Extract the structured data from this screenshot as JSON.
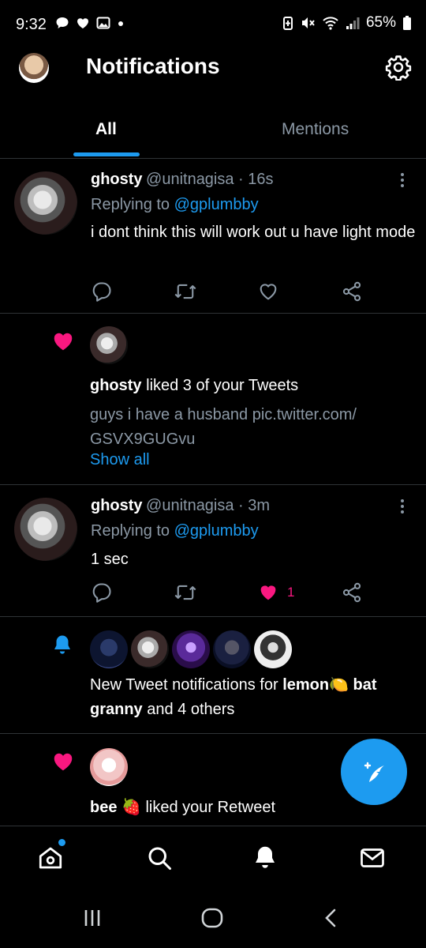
{
  "status_bar": {
    "time": "9:32",
    "battery": "65%"
  },
  "header": {
    "title": "Notifications"
  },
  "tabs": [
    {
      "label": "All"
    },
    {
      "label": "Mentions"
    }
  ],
  "notifications": [
    {
      "type": "reply",
      "name": "ghosty",
      "handle": "@unitnagisa · 16s",
      "replying_label": "Replying to",
      "replying_to": "@gplumbby",
      "text": "i dont think this will work out u have light mode"
    },
    {
      "type": "like",
      "name": "ghosty",
      "action": " liked 3 of your Tweets",
      "preview": "guys i have a husband pic.twitter.com/ GSVX9GUGvu",
      "show_all": "Show all"
    },
    {
      "type": "reply",
      "name": "ghosty",
      "handle": "@unitnagisa · 3m",
      "replying_label": "Replying to",
      "replying_to": "@gplumbby",
      "text": "1 sec",
      "like_count": "1"
    },
    {
      "type": "new_tweets",
      "text_prefix": "New Tweet notifications for ",
      "bold_name": "lemon🍋 bat granny",
      "text_suffix": " and 4 others"
    },
    {
      "type": "like",
      "name": "bee 🍓",
      "action": " liked your Retweet"
    }
  ],
  "colors": {
    "accent": "#1d9bf0",
    "like": "#f91880",
    "background": "#000000",
    "muted": "#8b98a5"
  },
  "icons": [
    "home-icon",
    "search-icon",
    "bell-icon",
    "mail-icon",
    "gear-icon",
    "compose-icon"
  ]
}
